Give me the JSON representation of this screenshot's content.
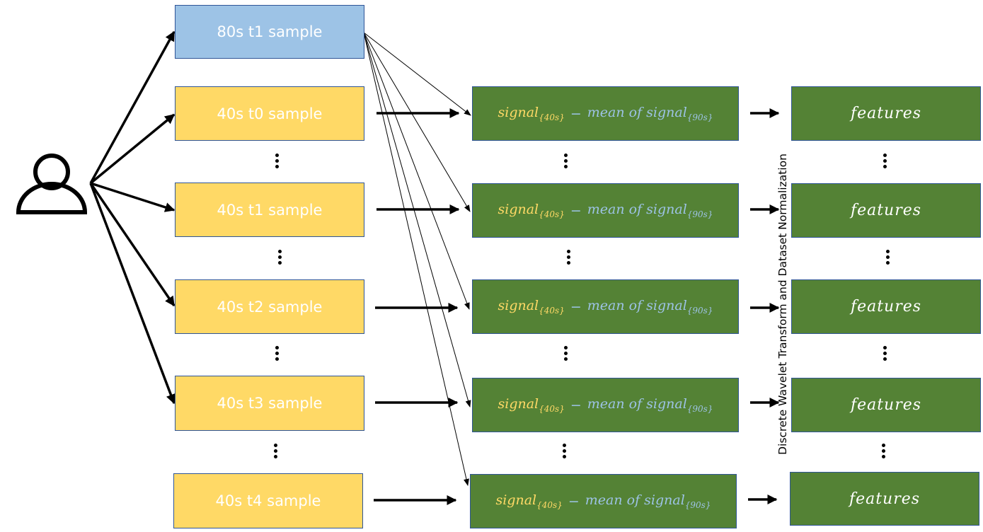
{
  "diagram": {
    "source_icon": "user-icon",
    "reference_sample": {
      "label": "80s t1 sample",
      "color": "#9dc3e6"
    },
    "samples": [
      {
        "label": "40s t0 sample"
      },
      {
        "label": "40s t1 sample"
      },
      {
        "label": "40s t2 sample"
      },
      {
        "label": "40s t3 sample"
      },
      {
        "label": "40s t4 sample"
      }
    ],
    "sample_color": "#ffd966",
    "formula": {
      "term_a": "signal",
      "term_a_sub": "{40s}",
      "operator": "−",
      "term_b": "mean of signal",
      "term_b_sub": "{90s}"
    },
    "formula_box_color": "#548235",
    "feature_label": "features",
    "transform_label": "Discrete Wavelet Transform and Dataset Normalization"
  }
}
